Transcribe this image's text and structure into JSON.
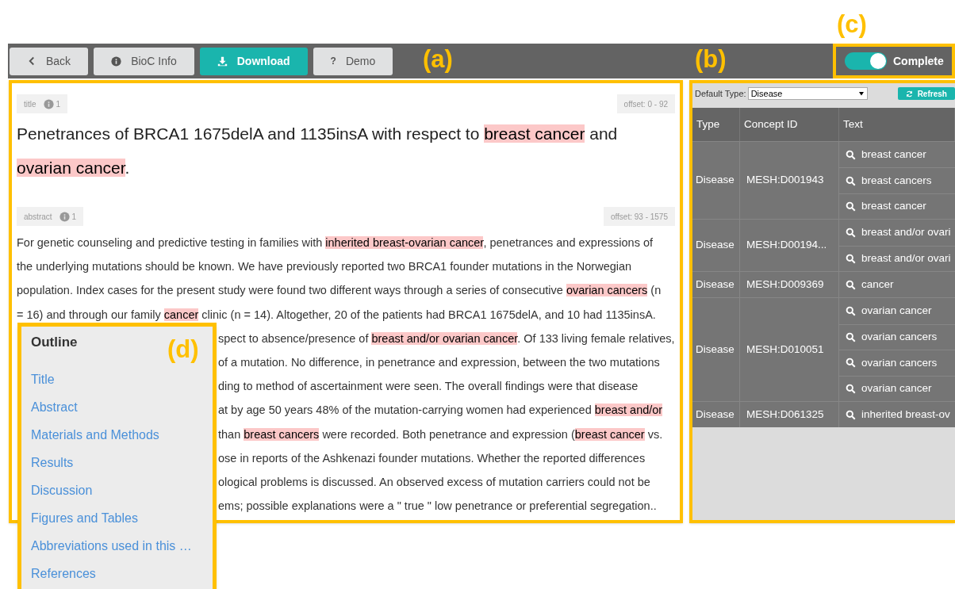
{
  "annotations": [
    {
      "label": "(c)"
    },
    {
      "label": "(a)"
    },
    {
      "label": "(b)"
    },
    {
      "label": "(d)"
    }
  ],
  "toolbar": {
    "buttons": [
      {
        "kind": "back",
        "label": "Back",
        "primary": false
      },
      {
        "kind": "info",
        "label": "BioC Info",
        "primary": false
      },
      {
        "kind": "download",
        "label": "Download",
        "primary": true
      },
      {
        "kind": "help",
        "glyph": "?",
        "label": "Demo",
        "primary": false
      }
    ],
    "toggle": {
      "label": "Complete",
      "on": true
    }
  },
  "document": {
    "sections": [
      {
        "tag": "title",
        "count": "1",
        "offset": "offset: 0 - 92",
        "kind": "heading",
        "lines": [
          [
            {
              "text": "Penetrances of BRCA1 1675delA and 1135insA with respect to ",
              "highlighted": false
            },
            {
              "text": "breast cancer",
              "highlighted": true
            },
            {
              "text": " and",
              "highlighted": false
            }
          ],
          [
            {
              "text": "ovarian cancer",
              "highlighted": true
            },
            {
              "text": ".",
              "highlighted": false
            }
          ]
        ]
      },
      {
        "tag": "abstract",
        "count": "1",
        "offset": "offset: 93 - 1575",
        "kind": "body",
        "lines": [
          [
            {
              "text": "For genetic counseling and predictive testing in families with ",
              "highlighted": false
            },
            {
              "text": "inherited breast-ovarian cancer",
              "highlighted": true
            },
            {
              "text": ", penetrances and expressions of",
              "highlighted": false
            }
          ],
          [
            {
              "text": "the underlying mutations should be known. We have previously reported two BRCA1 founder mutations in the Norwegian",
              "highlighted": false
            }
          ],
          [
            {
              "text": "population. Index cases for the present study were found two different ways through a series of consecutive ",
              "highlighted": false
            },
            {
              "text": "ovarian cancers",
              "highlighted": true
            },
            {
              "text": " (n",
              "highlighted": false
            }
          ],
          [
            {
              "text": "= 16) and through our family ",
              "highlighted": false
            },
            {
              "text": "cancer",
              "highlighted": true
            },
            {
              "text": " clinic (n = 14). Altogether, 20 of the patients had BRCA1 1675delA, and 10 had 1135insA.",
              "highlighted": false
            }
          ],
          [
            {
              "text": "spect to absence/presence of ",
              "highlighted": false
            },
            {
              "text": "breast and/or ovarian cancer",
              "highlighted": true
            },
            {
              "text": ". Of 133 living female relatives,",
              "highlighted": false
            }
          ],
          [
            {
              "text": "of a mutation. No difference, in penetrance and expression, between the two mutations",
              "highlighted": false
            }
          ],
          [
            {
              "text": "ding to method of ascertainment were seen. The overall findings were that disease",
              "highlighted": false
            }
          ],
          [
            {
              "text": "at by age 50 years 48% of the mutation-carrying women had experienced ",
              "highlighted": false
            },
            {
              "text": "breast and/or",
              "highlighted": true
            }
          ],
          [
            {
              "text": "than ",
              "highlighted": false
            },
            {
              "text": "breast cancers",
              "highlighted": true
            },
            {
              "text": " were recorded. Both penetrance and expression (",
              "highlighted": false
            },
            {
              "text": "breast cancer",
              "highlighted": true
            },
            {
              "text": " vs.",
              "highlighted": false
            }
          ],
          [
            {
              "text": "ose in reports of the Ashkenazi founder mutations. Whether the reported differences",
              "highlighted": false
            }
          ],
          [
            {
              "text": "ological problems is discussed. An observed excess of mutation carriers could not be",
              "highlighted": false
            }
          ],
          [
            {
              "text": "ems; possible explanations were a \" true \" low penetrance or preferential segregation..",
              "highlighted": false
            }
          ]
        ]
      }
    ]
  },
  "outline": {
    "title": "Outline",
    "items": [
      "Title",
      "Abstract",
      "Materials and Methods",
      "Results",
      "Discussion",
      "Figures and Tables",
      "Abbreviations used in this …",
      "References"
    ]
  },
  "annotation_panel": {
    "default_type_label": "Default Type:",
    "default_type": "Disease",
    "refresh": "Refresh",
    "columns": [
      "Type",
      "Concept ID",
      "Text"
    ],
    "rows": [
      {
        "type": "Disease",
        "concept_id": "MESH:D001943",
        "mentions": [
          "breast cancer",
          "breast cancers",
          "breast cancer"
        ]
      },
      {
        "type": "Disease",
        "concept_id": "MESH:D00194...",
        "mentions": [
          "breast and/or ovari",
          "breast and/or ovari"
        ]
      },
      {
        "type": "Disease",
        "concept_id": "MESH:D009369",
        "mentions": [
          "cancer"
        ]
      },
      {
        "type": "Disease",
        "concept_id": "MESH:D010051",
        "mentions": [
          "ovarian cancer",
          "ovarian cancers",
          "ovarian cancers",
          "ovarian cancer"
        ]
      },
      {
        "type": "Disease",
        "concept_id": "MESH:D061325",
        "mentions": [
          "inherited breast-ov"
        ]
      }
    ]
  }
}
